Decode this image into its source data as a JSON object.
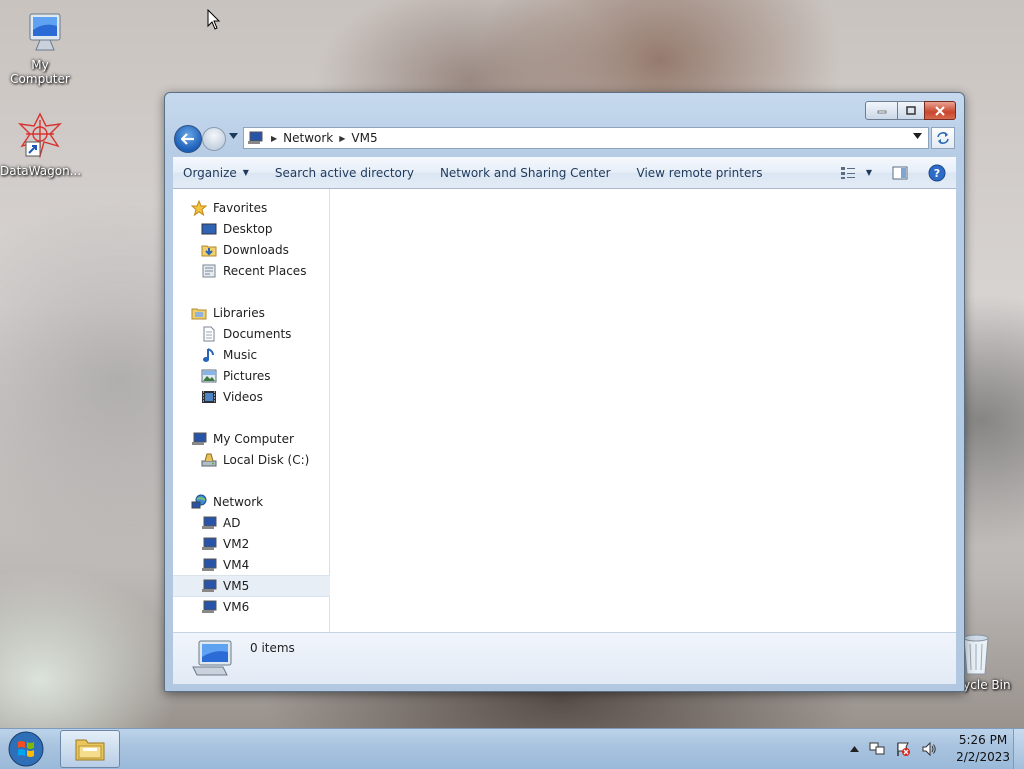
{
  "desktop": {
    "icons": [
      {
        "label": "My Computer"
      },
      {
        "label": "DataWagon..."
      },
      {
        "label": "Recycle Bin"
      }
    ]
  },
  "window": {
    "address": {
      "crumbs": [
        "Network",
        "VM5"
      ]
    },
    "toolbar": {
      "organize": "Organize",
      "search_ad": "Search active directory",
      "network_center": "Network and Sharing Center",
      "remote_printers": "View remote printers"
    },
    "nav": {
      "favorites": {
        "label": "Favorites",
        "items": [
          "Desktop",
          "Downloads",
          "Recent Places"
        ]
      },
      "libraries": {
        "label": "Libraries",
        "items": [
          "Documents",
          "Music",
          "Pictures",
          "Videos"
        ]
      },
      "computer": {
        "label": "My Computer",
        "items": [
          "Local Disk (C:)"
        ]
      },
      "network": {
        "label": "Network",
        "items": [
          "AD",
          "VM2",
          "VM4",
          "VM5",
          "VM6"
        ],
        "selected": "VM5"
      }
    },
    "status": {
      "count": "0 items"
    }
  },
  "taskbar": {
    "clock": {
      "time": "5:26 PM",
      "date": "2/2/2023"
    }
  }
}
